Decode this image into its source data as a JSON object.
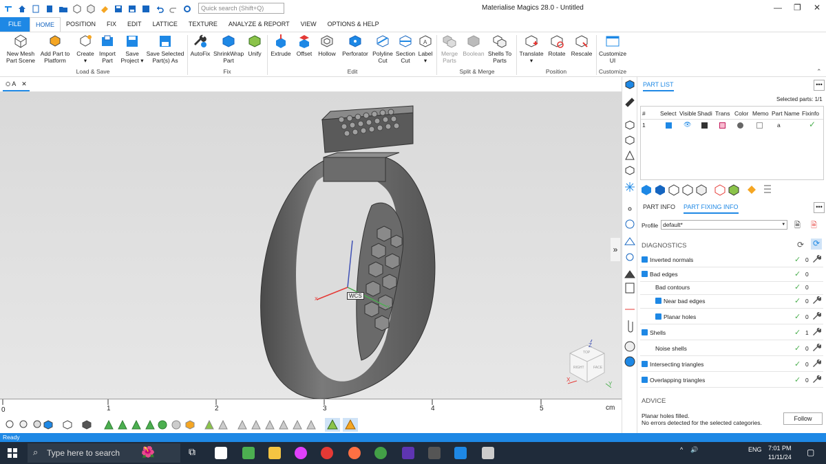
{
  "app": {
    "title": "Materialise Magics 28.0 - Untitled"
  },
  "search": {
    "placeholder": "Quick search (Shift+Q)"
  },
  "menu": {
    "tabs": [
      "FILE",
      "HOME",
      "POSITION",
      "FIX",
      "EDIT",
      "LATTICE",
      "TEXTURE",
      "ANALYZE & REPORT",
      "VIEW",
      "OPTIONS & HELP"
    ],
    "active": "HOME"
  },
  "ribbon": {
    "load_save": {
      "group": "Load & Save",
      "new_mesh": "New Mesh Part Scene",
      "add_part": "Add Part to Platform",
      "create": "Create",
      "import": "Import Part",
      "save_project": "Save Project",
      "save_selected": "Save Selected Part(s) As"
    },
    "fix": {
      "group": "Fix",
      "autofix": "AutoFix",
      "shrinkwrap": "ShrinkWrap Part",
      "unify": "Unify"
    },
    "edit": {
      "group": "Edit",
      "extrude": "Extrude",
      "offset": "Offset",
      "hollow": "Hollow",
      "perforator": "Perforator",
      "polyline_cut": "Polyline Cut",
      "section_cut": "Section Cut",
      "label": "Label"
    },
    "split_merge": {
      "group": "Split & Merge",
      "merge_parts": "Merge Parts",
      "boolean": "Boolean",
      "shells_to_parts": "Shells To Parts"
    },
    "position": {
      "group": "Position",
      "translate": "Translate",
      "rotate": "Rotate",
      "rescale": "Rescale"
    },
    "customize": {
      "group": "Customize",
      "customize_ui": "Customize UI"
    }
  },
  "document": {
    "tab": "A"
  },
  "viewport": {
    "wcs_label": "WCS",
    "cube_faces": [
      "TOP",
      "RIGHT",
      "FACE"
    ],
    "axes": [
      "X",
      "Y",
      "Z"
    ]
  },
  "ruler": {
    "ticks": [
      "0",
      "1",
      "2",
      "3",
      "4",
      "5"
    ],
    "unit": "cm"
  },
  "part_list": {
    "title": "PART LIST",
    "selected": "Selected parts: 1/1",
    "columns": [
      "#",
      "Select",
      "Visible",
      "Shading",
      "Transparency",
      "Color",
      "Memory",
      "Part Name",
      "Fixinfo"
    ],
    "rows": [
      {
        "num": "1",
        "name": "a"
      }
    ]
  },
  "info_tabs": {
    "part_info": "PART INFO",
    "part_fixing_info": "PART FIXING INFO"
  },
  "profile": {
    "label": "Profile",
    "value": "default*"
  },
  "diagnostics": {
    "title": "DIAGNOSTICS",
    "rows": [
      {
        "label": "Inverted normals",
        "count": "0"
      },
      {
        "label": "Bad edges",
        "count": "0"
      },
      {
        "label": "Bad contours",
        "count": "0"
      },
      {
        "label": "Near bad edges",
        "count": "0"
      },
      {
        "label": "Planar holes",
        "count": "0"
      },
      {
        "label": "Shells",
        "count": "1"
      },
      {
        "label": "Noise shells",
        "count": "0"
      },
      {
        "label": "Intersecting triangles",
        "count": "0"
      },
      {
        "label": "Overlapping triangles",
        "count": "0"
      }
    ]
  },
  "advice": {
    "title": "ADVICE",
    "line1": "Planar holes filled.",
    "line2": "No errors detected for the selected categories.",
    "follow": "Follow"
  },
  "status": {
    "text": "Ready"
  },
  "taskbar": {
    "search_placeholder": "Type here to search",
    "lang": "ENG",
    "time": "7:01 PM",
    "date": "11/11/24"
  },
  "colors": {
    "accent": "#1e88e5",
    "taskbar": "#1f2b3a",
    "check": "#4caf50"
  }
}
